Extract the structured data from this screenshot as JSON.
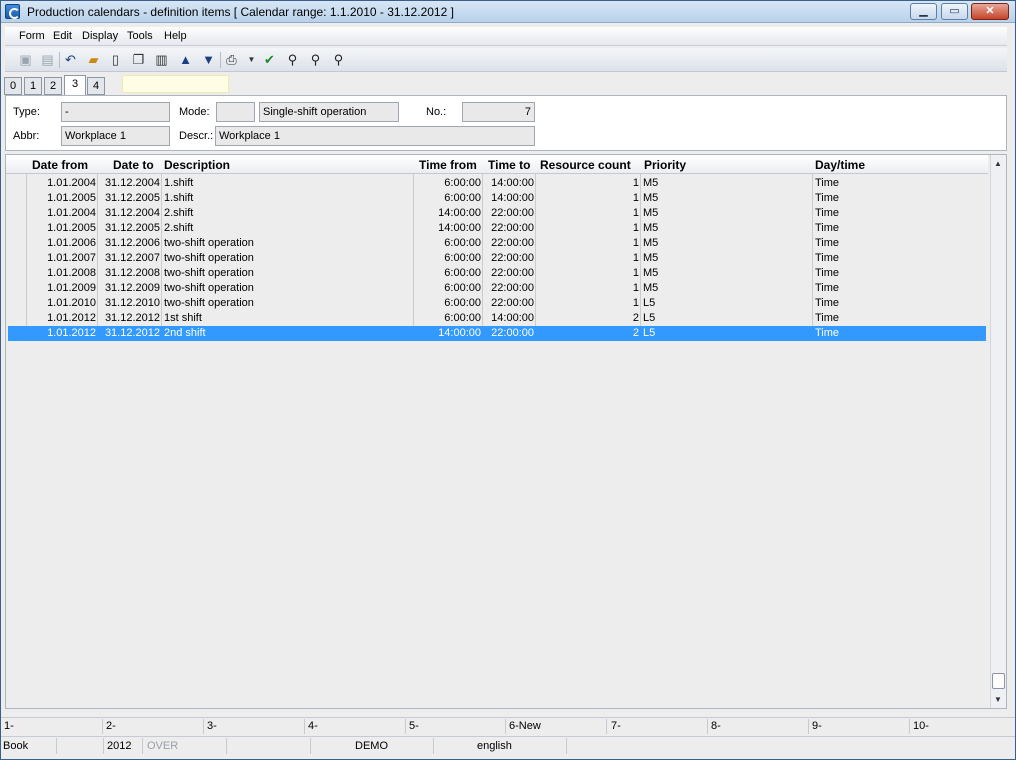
{
  "window": {
    "title": "Production calendars - definition items   [ Calendar range: 1.1.2010 - 31.12.2012 ]",
    "minimize_label": "▁",
    "maximize_label": "▭",
    "close_label": "✕"
  },
  "menu": {
    "items": [
      "Form",
      "Edit",
      "Display",
      "Tools",
      "Help"
    ]
  },
  "toolbar": {
    "icons": [
      "save-icon",
      "save-as-icon",
      "undo-icon",
      "open-folder-icon",
      "new-document-icon",
      "copy-icon",
      "book-icon",
      "arrow-up-icon",
      "arrow-down-icon",
      "print-icon",
      "dropdown-icon",
      "filter-check-icon",
      "find-icon",
      "find-next-icon",
      "find-options-icon"
    ]
  },
  "tabs": {
    "items": [
      "0",
      "1",
      "2",
      "3",
      "4"
    ],
    "active": "3"
  },
  "form": {
    "type_label": "Type:",
    "type_value": "-",
    "mode_label": "Mode:",
    "mode_code": "",
    "mode_value": "Single-shift operation",
    "no_label": "No.:",
    "no_value": "7",
    "abbr_label": "Abbr:",
    "abbr_value": "Workplace 1",
    "descr_label": "Descr.:",
    "descr_value": "Workplace 1"
  },
  "grid": {
    "columns": [
      "Date from",
      "Date to",
      "Description",
      "Time from",
      "Time to",
      "Resource count",
      "Priority",
      "Day/time"
    ],
    "rows": [
      [
        "1.01.2004",
        "31.12.2004",
        "1.shift",
        "6:00:00",
        "14:00:00",
        "1",
        "M5",
        "Time"
      ],
      [
        "1.01.2005",
        "31.12.2005",
        "1.shift",
        "6:00:00",
        "14:00:00",
        "1",
        "M5",
        "Time"
      ],
      [
        "1.01.2004",
        "31.12.2004",
        "2.shift",
        "14:00:00",
        "22:00:00",
        "1",
        "M5",
        "Time"
      ],
      [
        "1.01.2005",
        "31.12.2005",
        "2.shift",
        "14:00:00",
        "22:00:00",
        "1",
        "M5",
        "Time"
      ],
      [
        "1.01.2006",
        "31.12.2006",
        "two-shift operation",
        "6:00:00",
        "22:00:00",
        "1",
        "M5",
        "Time"
      ],
      [
        "1.01.2007",
        "31.12.2007",
        "two-shift operation",
        "6:00:00",
        "22:00:00",
        "1",
        "M5",
        "Time"
      ],
      [
        "1.01.2008",
        "31.12.2008",
        "two-shift operation",
        "6:00:00",
        "22:00:00",
        "1",
        "M5",
        "Time"
      ],
      [
        "1.01.2009",
        "31.12.2009",
        "two-shift operation",
        "6:00:00",
        "22:00:00",
        "1",
        "M5",
        "Time"
      ],
      [
        "1.01.2010",
        "31.12.2010",
        "two-shift operation",
        "6:00:00",
        "22:00:00",
        "1",
        "L5",
        "Time"
      ],
      [
        "1.01.2012",
        "31.12.2012",
        "1st shift",
        "6:00:00",
        "14:00:00",
        "2",
        "L5",
        "Time"
      ],
      [
        "1.01.2012",
        "31.12.2012",
        "2nd shift",
        "14:00:00",
        "22:00:00",
        "2",
        "L5",
        "Time"
      ]
    ],
    "selected_row": 10
  },
  "fkeys": [
    "1-",
    "2-",
    "3-",
    "4-",
    "5-",
    "6-New",
    "7-",
    "8-",
    "9-",
    "10-"
  ],
  "status": {
    "book": "Book",
    "year": "2012",
    "mode": "OVER",
    "db": "DEMO",
    "language": "english"
  },
  "colors": {
    "selection": "#3399ff",
    "titlebar": "#c9dcf0"
  }
}
